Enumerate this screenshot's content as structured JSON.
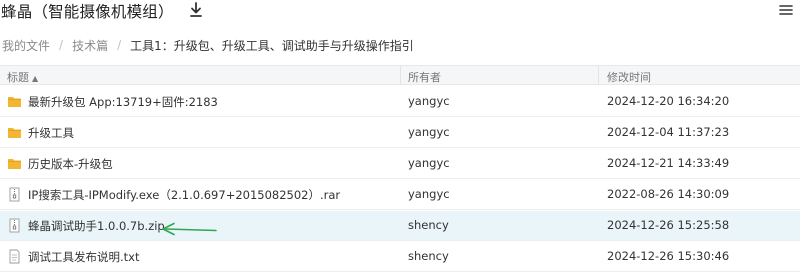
{
  "app": {
    "title": "蜂晶（智能摄像机模组）"
  },
  "toolbar": {
    "download_icon": "download-icon",
    "menu_icon": "menu-icon"
  },
  "breadcrumb": {
    "items": [
      "我的文件",
      "技术篇"
    ],
    "separator": "/",
    "current": "工具1：升级包、升级工具、调试助手与升级操作指引"
  },
  "table": {
    "columns": {
      "name": "标题",
      "sort_indicator": "▲",
      "owner": "所有者",
      "modified": "修改时间"
    },
    "rows": [
      {
        "type": "folder",
        "name": "最新升级包 App:13719+固件:2183",
        "owner": "yangyc",
        "modified": "2024-12-20 16:34:20",
        "selected": false
      },
      {
        "type": "folder",
        "name": "升级工具",
        "owner": "yangyc",
        "modified": "2024-12-04 11:37:23",
        "selected": false
      },
      {
        "type": "folder",
        "name": "历史版本-升级包",
        "owner": "yangyc",
        "modified": "2024-12-21 14:33:49",
        "selected": false
      },
      {
        "type": "archive",
        "name": "IP搜索工具-IPModify.exe（2.1.0.697+2015082502）.rar",
        "owner": "yangyc",
        "modified": "2022-08-26 14:30:09",
        "selected": false
      },
      {
        "type": "archive",
        "name": "蜂晶调试助手1.0.0.7b.zip",
        "owner": "shency",
        "modified": "2024-12-26 15:25:58",
        "selected": true
      },
      {
        "type": "text",
        "name": "调试工具发布说明.txt",
        "owner": "shency",
        "modified": "2024-12-26 15:30:46",
        "selected": false
      }
    ]
  },
  "colors": {
    "folder": "#f2b632",
    "selected_row": "#e9f5f9",
    "annotation_arrow": "#2fa84f"
  }
}
